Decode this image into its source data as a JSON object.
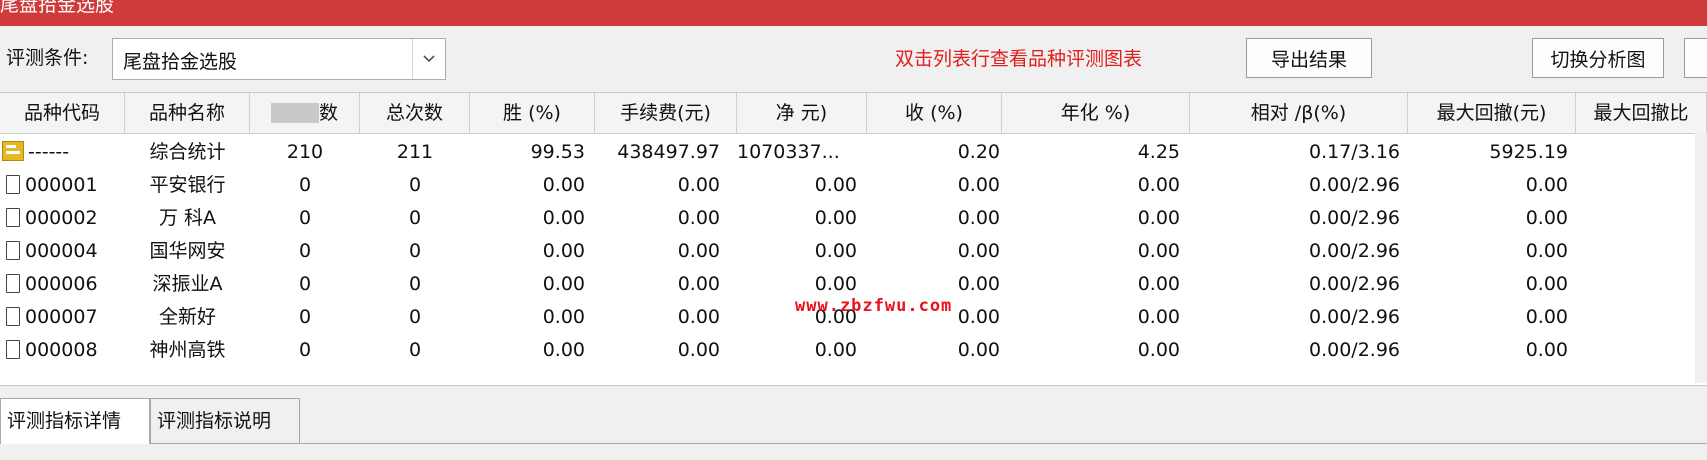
{
  "window": {
    "title": "尾盘拾金选股"
  },
  "toolbar": {
    "condition_label": "评测条件:",
    "condition_value": "尾盘拾金选股",
    "hint": "双击列表行查看品种评测图表",
    "export_label": "导出结果",
    "switch_label": "切换分析图"
  },
  "table": {
    "headers": [
      "品种代码",
      "品种名称",
      "数",
      "总次数",
      "胜 (%)",
      "手续费(元)",
      "净 元)",
      "收 (%)",
      "年化 %)",
      "相对 /β(%)",
      "最大回撤(元)",
      "最大回撤比"
    ],
    "summary": [
      "------",
      "综合统计",
      "210",
      "211",
      "99.53",
      "438497.97",
      "1070337...",
      "0.20",
      "4.25",
      "0.17/3.16",
      "5925.19"
    ],
    "rows": [
      [
        "000001",
        "平安银行",
        "0",
        "0",
        "0.00",
        "0.00",
        "0.00",
        "0.00",
        "0.00",
        "0.00/2.96",
        "0.00"
      ],
      [
        "000002",
        "万 科A",
        "0",
        "0",
        "0.00",
        "0.00",
        "0.00",
        "0.00",
        "0.00",
        "0.00/2.96",
        "0.00"
      ],
      [
        "000004",
        "国华网安",
        "0",
        "0",
        "0.00",
        "0.00",
        "0.00",
        "0.00",
        "0.00",
        "0.00/2.96",
        "0.00"
      ],
      [
        "000006",
        "深振业A",
        "0",
        "0",
        "0.00",
        "0.00",
        "0.00",
        "0.00",
        "0.00",
        "0.00/2.96",
        "0.00"
      ],
      [
        "000007",
        "全新好",
        "0",
        "0",
        "0.00",
        "0.00",
        "0.00",
        "0.00",
        "0.00",
        "0.00/2.96",
        "0.00"
      ],
      [
        "000008",
        "神州高铁",
        "0",
        "0",
        "0.00",
        "0.00",
        "0.00",
        "0.00",
        "0.00",
        "0.00/2.96",
        "0.00"
      ]
    ]
  },
  "watermark": "www.zbzfwu.com",
  "tabs": [
    "评测指标详情",
    "评测指标说明"
  ]
}
